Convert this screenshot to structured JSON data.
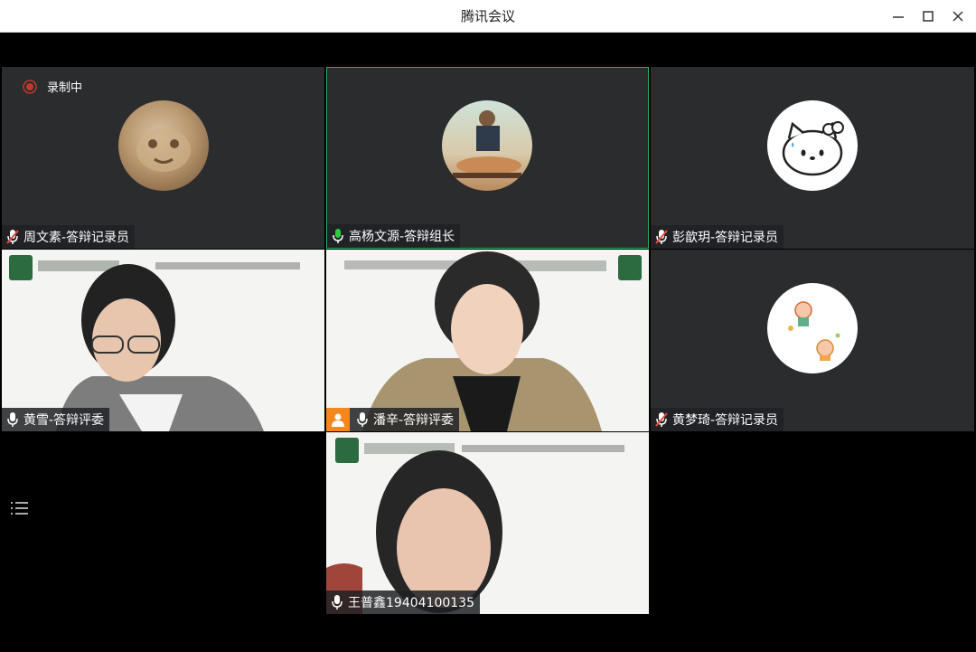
{
  "window": {
    "title": "腾讯会议",
    "minimize_icon": "minimize-icon",
    "maximize_icon": "maximize-icon",
    "close_icon": "close-icon"
  },
  "recording": {
    "label": "录制中",
    "color": "#c0392b"
  },
  "participants": [
    {
      "name": "周文素-答辩记录员",
      "mic": "muted",
      "avatar": "cat-photo"
    },
    {
      "name": "高杨文源-答辩组长",
      "mic": "speaking",
      "avatar": "massage-photo",
      "active": true
    },
    {
      "name": "彭歆玥-答辩记录员",
      "mic": "muted",
      "avatar": "hello-kitty"
    },
    {
      "name": "黄雪-答辩评委",
      "mic": "on",
      "video": true
    },
    {
      "name": "潘辛-答辩评委",
      "mic": "on",
      "video": true,
      "host_badge": true
    },
    {
      "name": "黄梦琦-答辩记录员",
      "mic": "muted",
      "avatar": "cartoon-stickers"
    },
    {
      "name": "王普鑫19404100135",
      "mic": "on",
      "video": true
    }
  ],
  "colors": {
    "tile_dark": "#2b2c2e",
    "active_border": "#1fb85a",
    "speaking_mic": "#2ecc40",
    "muted_mic": "#e74c3c",
    "host_badge": "#f5871f"
  }
}
